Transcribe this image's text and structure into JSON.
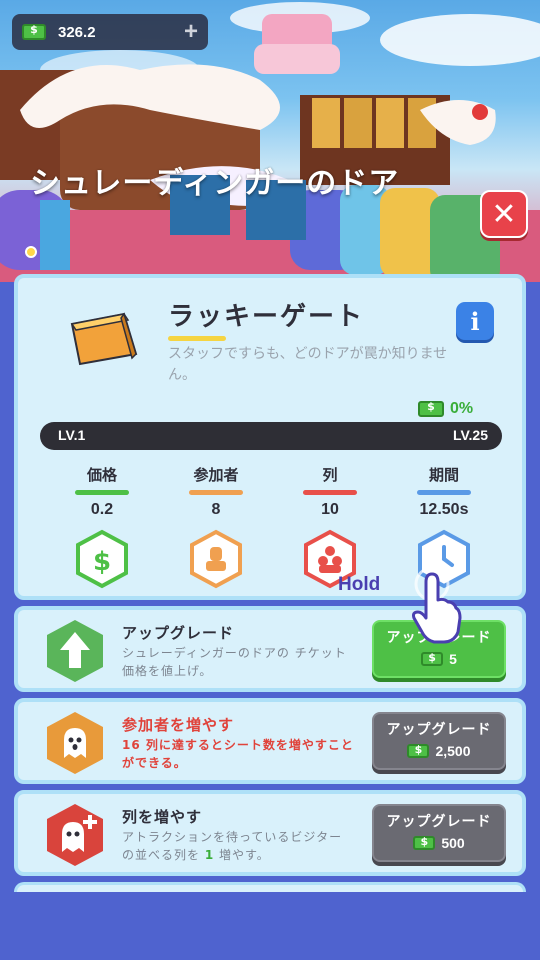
{
  "currency": {
    "icon": "cash-icon",
    "amount": "326.2",
    "add_icon": "plus-icon"
  },
  "scene": {
    "title": "シュレーディンガーのドア"
  },
  "card": {
    "name": "ラッキーゲート",
    "description": "スタッフですらも、どのドアが罠か知りません。",
    "progress_percent": "0%",
    "level_min": "LV.1",
    "level_max": "LV.25",
    "level_fill_fraction": 0,
    "stats": [
      {
        "label": "価格",
        "value": "0.2",
        "color": "#4ec046",
        "icon": "dollar-icon"
      },
      {
        "label": "参加者",
        "value": "8",
        "color": "#f0a050",
        "icon": "person-icon"
      },
      {
        "label": "列",
        "value": "10",
        "color": "#e8504a",
        "icon": "queue-icon"
      },
      {
        "label": "期間",
        "value": "12.50s",
        "color": "#5a9ae6",
        "icon": "clock-icon"
      }
    ]
  },
  "upgrades": [
    {
      "title": "アップグレード",
      "description": "シュレーディンガーのドアの チケット価格を値上げ。",
      "button_label": "アップグレード",
      "cost": "5",
      "style": "green"
    },
    {
      "title": "参加者を増やす",
      "description": "16 列に達するとシート数を増やすことができる。",
      "button_label": "アップグレード",
      "cost": "2,500",
      "style": "gray"
    },
    {
      "title": "列を増やす",
      "description_before": "アトラクションを待っているビジターの並べる列を ",
      "description_highlight": "1",
      "description_after": " 増やす。",
      "button_label": "アップグレード",
      "cost": "500",
      "style": "gray"
    }
  ],
  "tutorial": {
    "hint": "Hold"
  },
  "colors": {
    "accent_green": "#4ec046",
    "danger_red": "#e8424a",
    "background": "#4f63cf"
  }
}
